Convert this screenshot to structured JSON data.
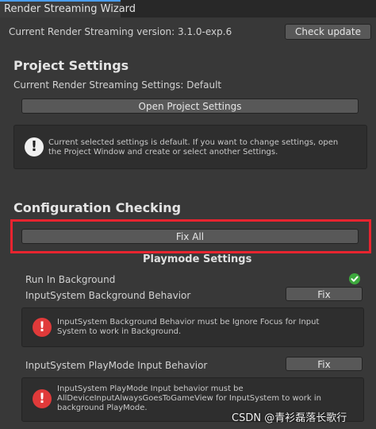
{
  "window": {
    "tab_title": "Render Streaming Wizard"
  },
  "header": {
    "version_text": "Current Render Streaming version: 3.1.0-exp.6",
    "check_update_label": "Check update"
  },
  "project_settings": {
    "title": "Project Settings",
    "current_settings_text": "Current Render Streaming Settings: Default",
    "open_button_label": "Open Project Settings",
    "info_message_line1": "Current selected settings is default. If you want to change settings, open",
    "info_message_line2": "the Project Window and create or select another Settings."
  },
  "configuration": {
    "title": "Configuration Checking",
    "fix_all_label": "Fix All",
    "playmode_title": "Playmode Settings",
    "items": [
      {
        "label": "Run In Background",
        "status": "ok"
      },
      {
        "label": "InputSystem Background Behavior",
        "fix_label": "Fix",
        "error_line1": "InputSystem Background Behavior must be Ignore Focus for Input",
        "error_line2": "System to work in Background."
      },
      {
        "label": "InputSystem PlayMode Input Behavior",
        "fix_label": "Fix",
        "error_line1": "InputSystem PlayMode Input behavior must be",
        "error_line2": "AllDeviceInputAlwaysGoesToGameView for InputSystem to work in",
        "error_line3": "background PlayMode."
      }
    ]
  },
  "icons": {
    "info": "info-icon",
    "error": "error-icon",
    "check": "checkmark-icon"
  },
  "colors": {
    "background": "#383838",
    "highlight_frame": "#e8242f",
    "ok_green": "#3da83d",
    "error_red": "#e03a3a"
  },
  "watermark": "CSDN @青衫磊落长歌行"
}
